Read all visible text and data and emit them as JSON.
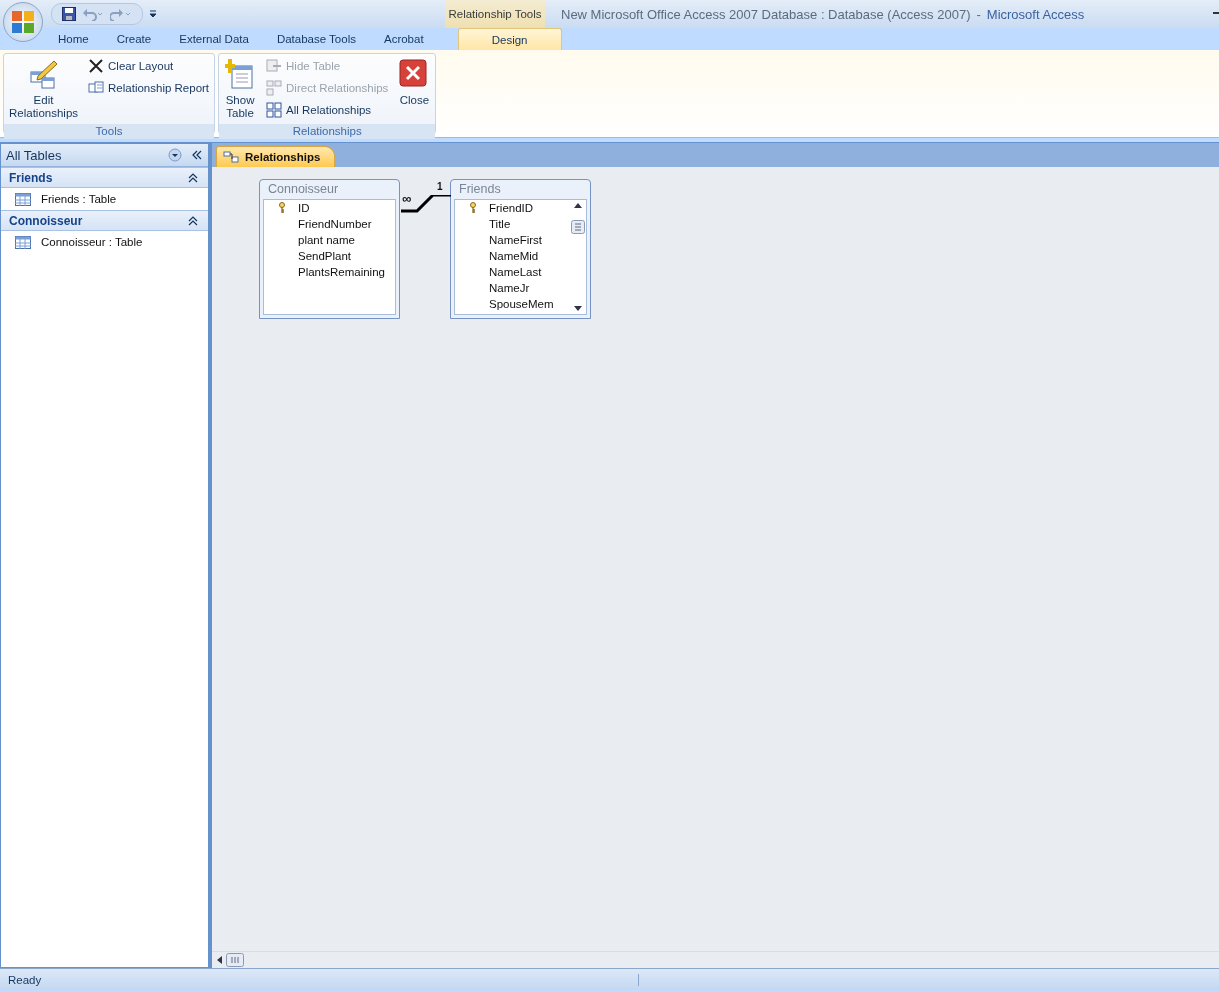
{
  "window": {
    "document_title": "New Microsoft Office Access 2007 Database : Database (Access 2007)",
    "separator": "-",
    "app_name": "Microsoft Access",
    "contextual_group": "Relationship Tools"
  },
  "tabs": [
    {
      "label": "Home",
      "selected": false
    },
    {
      "label": "Create",
      "selected": false
    },
    {
      "label": "External Data",
      "selected": false
    },
    {
      "label": "Database Tools",
      "selected": false
    },
    {
      "label": "Acrobat",
      "selected": false
    },
    {
      "label": "Design",
      "selected": true
    }
  ],
  "ribbon_groups": [
    {
      "title": "Tools",
      "items": [
        {
          "label": "Edit Relationships",
          "kind": "large",
          "disabled": false
        },
        {
          "label": "Clear Layout",
          "kind": "small",
          "disabled": false
        },
        {
          "label": "Relationship Report",
          "kind": "small",
          "disabled": false
        }
      ]
    },
    {
      "title": "Relationships",
      "items": [
        {
          "label": "Show Table",
          "kind": "large",
          "disabled": false
        },
        {
          "label": "Hide Table",
          "kind": "small",
          "disabled": true
        },
        {
          "label": "Direct Relationships",
          "kind": "small",
          "disabled": true
        },
        {
          "label": "All Relationships",
          "kind": "small",
          "disabled": false
        },
        {
          "label": "Close",
          "kind": "large",
          "disabled": false
        }
      ]
    }
  ],
  "nav_pane": {
    "title": "All Tables",
    "groups": [
      {
        "title": "Friends",
        "expanded": true,
        "items": [
          "Friends : Table"
        ]
      },
      {
        "title": "Connoisseur",
        "expanded": true,
        "items": [
          "Connoisseur : Table"
        ]
      }
    ]
  },
  "document_tab": {
    "label": "Relationships"
  },
  "tables": [
    {
      "title": "Connoisseur",
      "scrollable": false,
      "fields": [
        {
          "name": "ID",
          "primary_key": true
        },
        {
          "name": "FriendNumber",
          "primary_key": false
        },
        {
          "name": "plant name",
          "primary_key": false
        },
        {
          "name": "SendPlant",
          "primary_key": false
        },
        {
          "name": "PlantsRemaining",
          "primary_key": false
        }
      ]
    },
    {
      "title": "Friends",
      "scrollable": true,
      "fields": [
        {
          "name": "FriendID",
          "primary_key": true
        },
        {
          "name": "Title",
          "primary_key": false
        },
        {
          "name": "NameFirst",
          "primary_key": false
        },
        {
          "name": "NameMid",
          "primary_key": false
        },
        {
          "name": "NameLast",
          "primary_key": false
        },
        {
          "name": "NameJr",
          "primary_key": false
        },
        {
          "name": "SpouseMem",
          "primary_key": false
        }
      ]
    }
  ],
  "relationship": {
    "many_label": "∞",
    "one_label": "1"
  },
  "status_bar": {
    "text": "Ready"
  }
}
